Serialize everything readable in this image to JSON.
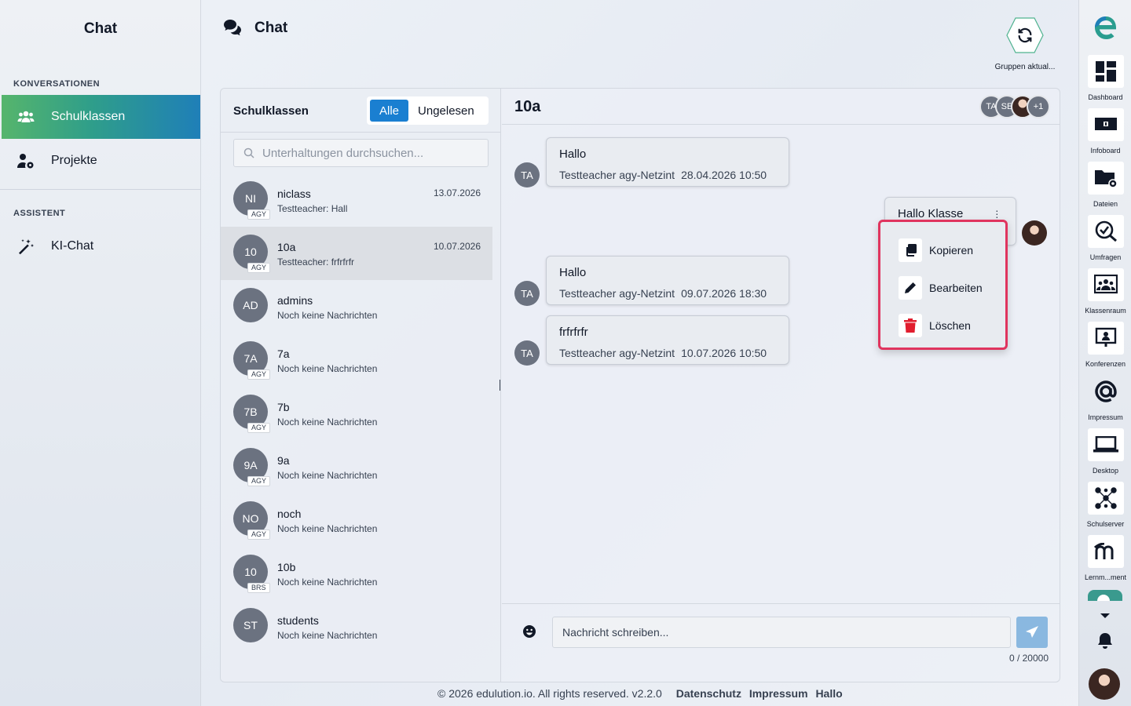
{
  "sidebar": {
    "title": "Chat",
    "section_conversations": "KONVERSATIONEN",
    "items": [
      {
        "label": "Schulklassen",
        "icon": "users-icon",
        "active": true
      },
      {
        "label": "Projekte",
        "icon": "user-gear-icon",
        "active": false
      }
    ],
    "section_assistant": "ASSISTENT",
    "assistant_items": [
      {
        "label": "KI-Chat",
        "icon": "magic-wand-icon"
      }
    ]
  },
  "header": {
    "title": "Chat",
    "refresh_label": "Gruppen aktual..."
  },
  "conversations": {
    "title": "Schulklassen",
    "filters": [
      "Alle",
      "Ungelesen"
    ],
    "active_filter": "Alle",
    "search_placeholder": "Unterhaltungen durchsuchen...",
    "items": [
      {
        "initials": "NI",
        "badge": "AGY",
        "name": "niclass",
        "preview": "Testteacher: Hall",
        "date": "13.07.2026"
      },
      {
        "initials": "10",
        "badge": "AGY",
        "name": "10a",
        "preview": "Testteacher: frfrfrfr",
        "date": "10.07.2026",
        "selected": true
      },
      {
        "initials": "AD",
        "badge": "",
        "name": "admins",
        "preview": "Noch keine Nachrichten",
        "date": ""
      },
      {
        "initials": "7A",
        "badge": "AGY",
        "name": "7a",
        "preview": "Noch keine Nachrichten",
        "date": ""
      },
      {
        "initials": "7B",
        "badge": "AGY",
        "name": "7b",
        "preview": "Noch keine Nachrichten",
        "date": ""
      },
      {
        "initials": "9A",
        "badge": "AGY",
        "name": "9a",
        "preview": "Noch keine Nachrichten",
        "date": ""
      },
      {
        "initials": "NO",
        "badge": "AGY",
        "name": "noch",
        "preview": "Noch keine Nachrichten",
        "date": ""
      },
      {
        "initials": "10",
        "badge": "BRS",
        "name": "10b",
        "preview": "Noch keine Nachrichten",
        "date": ""
      },
      {
        "initials": "ST",
        "badge": "",
        "name": "students",
        "preview": "Noch keine Nachrichten",
        "date": ""
      }
    ]
  },
  "chat": {
    "title": "10a",
    "members": [
      "TA",
      "SE",
      "+1"
    ],
    "messages": [
      {
        "avatar": "TA",
        "text": "Hallo",
        "sender": "Testteacher agy-Netzint",
        "time": "28.04.2026 10:50"
      },
      {
        "avatar": "TA",
        "text": "Hallo",
        "sender": "Testteacher agy-Netzint",
        "time": "09.07.2026 18:30"
      },
      {
        "avatar": "TA",
        "text": "frfrfrfr",
        "sender": "Testteacher agy-Netzint",
        "time": "10.07.2026 10:50"
      }
    ],
    "own_message": {
      "text": "Hallo Klasse"
    },
    "context_menu": [
      "Kopieren",
      "Bearbeiten",
      "Löschen"
    ],
    "composer_placeholder": "Nachricht schreiben...",
    "char_count": "0 / 20000"
  },
  "footer": {
    "copyright": "© 2026 edulution.io. All rights reserved. v2.2.0",
    "links": [
      "Datenschutz",
      "Impressum",
      "Hallo"
    ]
  },
  "dock": {
    "items": [
      {
        "label": "Dashboard",
        "icon": "dashboard-icon"
      },
      {
        "label": "Infoboard",
        "icon": "infoboard-icon"
      },
      {
        "label": "Dateien",
        "icon": "folder-icon"
      },
      {
        "label": "Umfragen",
        "icon": "survey-icon"
      },
      {
        "label": "Klassenraum",
        "icon": "classroom-icon"
      },
      {
        "label": "Konferenzen",
        "icon": "conference-icon"
      },
      {
        "label": "Impressum",
        "icon": "at-icon"
      },
      {
        "label": "Desktop",
        "icon": "laptop-icon"
      },
      {
        "label": "Schulserver",
        "icon": "network-icon"
      },
      {
        "label": "Lernm...ment",
        "icon": "moodle-icon"
      }
    ]
  },
  "colors": {
    "accent": "#1a7fd1",
    "active_gradient_start": "#56b56c",
    "active_gradient_end": "#1f7fb8",
    "context_border": "#e0345e",
    "delete_icon": "#e11d2e"
  }
}
